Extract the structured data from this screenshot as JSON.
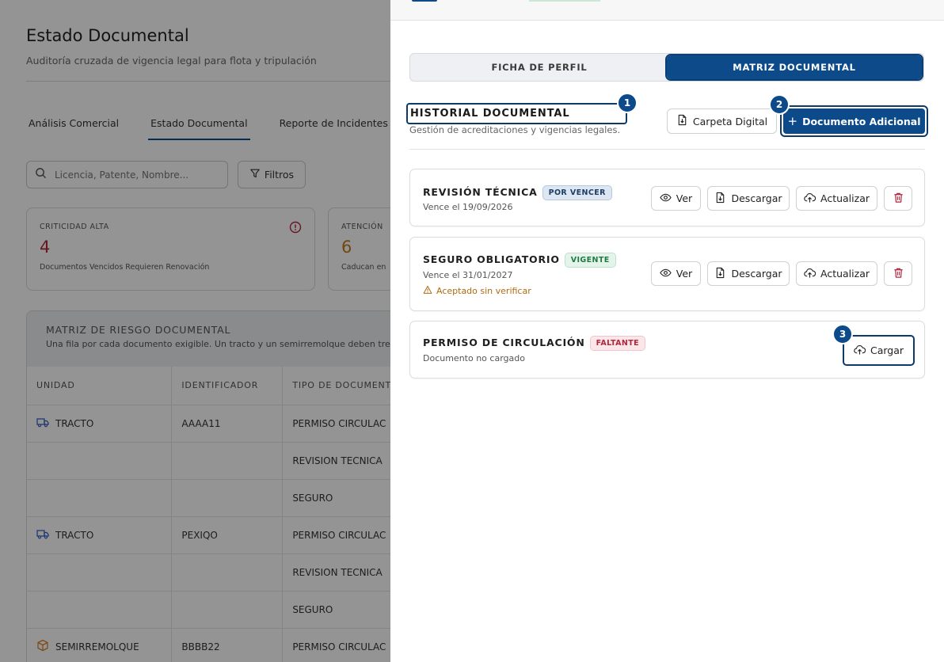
{
  "background": {
    "title": "Estado Documental",
    "subtitle": "Auditoría cruzada de vigencia legal para flota y tripulación",
    "tabs": [
      "Análisis Comercial",
      "Estado Documental",
      "Reporte de Incidentes"
    ],
    "search_placeholder": "Licencia, Patente, Nombre...",
    "filter_label": "Filtros",
    "kpis": [
      {
        "label": "CRITICIDAD ALTA",
        "value": "4",
        "desc": "Documentos Vencidos Requieren Renovación",
        "color": "#b3263c"
      },
      {
        "label": "ATENCIÓN",
        "value": "6",
        "desc": "Caducan en",
        "color": "#c07a1b"
      }
    ],
    "matrix": {
      "title": "MATRIZ DE RIESGO DOCUMENTAL",
      "subtitle": "Una fila por cada documento exigible. Un tracto y un semirremolque deben tre",
      "columns": [
        "UNIDAD",
        "IDENTIFICADOR",
        "TIPO DE DOCUMENT"
      ],
      "rows": [
        {
          "unit": "TRACTO",
          "unit_icon": "truck-icon",
          "id": "AAAA11",
          "doc": "PERMISO CIRCULAC"
        },
        {
          "unit": "",
          "unit_icon": "",
          "id": "",
          "doc": "REVISION TECNICA"
        },
        {
          "unit": "",
          "unit_icon": "",
          "id": "",
          "doc": "SEGURO"
        },
        {
          "unit": "TRACTO",
          "unit_icon": "truck-icon",
          "id": "PEXIQO",
          "doc": "PERMISO CIRCULAC"
        },
        {
          "unit": "",
          "unit_icon": "",
          "id": "",
          "doc": "REVISION TECNICA"
        },
        {
          "unit": "",
          "unit_icon": "",
          "id": "",
          "doc": "SEGURO"
        },
        {
          "unit": "SEMIRREMOLQUE",
          "unit_icon": "box-icon",
          "id": "BBBB22",
          "doc": "PERMISO CIRCULAC"
        }
      ]
    }
  },
  "drawer": {
    "segments": [
      {
        "label": "FICHA DE PERFIL",
        "active": false
      },
      {
        "label": "MATRIZ DOCUMENTAL",
        "active": true
      }
    ],
    "history": {
      "title": "HISTORIAL DOCUMENTAL",
      "subtitle": "Gestión de acreditaciones y vigencias legales.",
      "carpeta_label": "Carpeta Digital",
      "add_label": "Documento Adicional"
    },
    "step_badges": [
      "1",
      "2",
      "3"
    ],
    "documents": [
      {
        "name": "REVISIÓN TÉCNICA",
        "status": "POR VENCER",
        "meta": "Vence el 19/09/2026",
        "note": ""
      },
      {
        "name": "SEGURO OBLIGATORIO",
        "status": "VIGENTE",
        "meta": "Vence el 31/01/2027",
        "note": "Aceptado sin verificar"
      },
      {
        "name": "PERMISO DE CIRCULACIÓN",
        "status": "FALTANTE",
        "meta": "Documento no cargado",
        "note": ""
      }
    ],
    "actions": {
      "ver": "Ver",
      "descargar": "Descargar",
      "actualizar": "Actualizar",
      "cargar": "Cargar"
    },
    "colors": {
      "primary": "#0d4a8a",
      "danger": "#b3263c",
      "success": "#1f7a44",
      "warning": "#b06a10"
    }
  }
}
